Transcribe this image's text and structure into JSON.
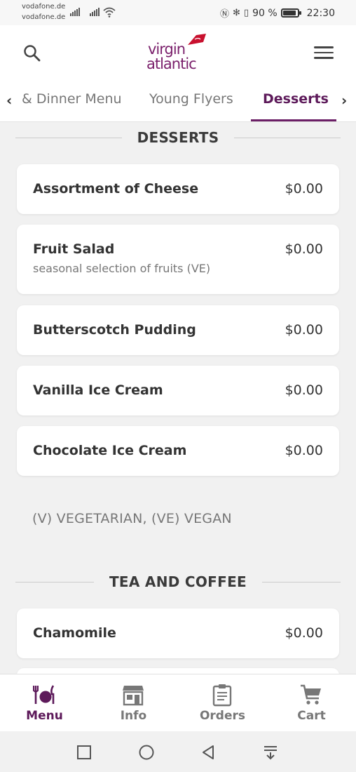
{
  "status_bar": {
    "carrier_1": "vodafone.de",
    "carrier_2": "vodafone.de",
    "battery_text": "90 %",
    "battery_level": 0.9,
    "time": "22:30"
  },
  "header": {
    "logo_line_1": "virgin",
    "logo_line_2": "atlantic",
    "brand_color": "#7a1f6b",
    "icons": [
      "search-icon",
      "hamburger-menu-icon"
    ]
  },
  "tabs": {
    "prev_label": "‹",
    "next_label": "›",
    "items": [
      {
        "label": "& Dinner Menu",
        "active": false
      },
      {
        "label": "Young Flyers",
        "active": false
      },
      {
        "label": "Desserts",
        "active": true
      }
    ]
  },
  "sections": [
    {
      "title": "DESSERTS",
      "items": [
        {
          "name": "Assortment of Cheese",
          "description": "",
          "price": "$0.00"
        },
        {
          "name": "Fruit Salad",
          "description": "seasonal selection of fruits (VE)",
          "price": "$0.00"
        },
        {
          "name": "Butterscotch Pudding",
          "description": "",
          "price": "$0.00"
        },
        {
          "name": "Vanilla Ice Cream",
          "description": "",
          "price": "$0.00"
        },
        {
          "name": "Chocolate Ice Cream",
          "description": "",
          "price": "$0.00"
        }
      ],
      "legend": "(V) VEGETARIAN, (VE) VEGAN"
    },
    {
      "title": "TEA AND COFFEE",
      "items": [
        {
          "name": "Chamomile",
          "description": "",
          "price": "$0.00"
        }
      ]
    }
  ],
  "bottom_nav": {
    "items": [
      {
        "label": "Menu",
        "icon": "cutlery-plate-icon",
        "active": true
      },
      {
        "label": "Info",
        "icon": "storefront-icon",
        "active": false
      },
      {
        "label": "Orders",
        "icon": "clipboard-icon",
        "active": false
      },
      {
        "label": "Cart",
        "icon": "cart-icon",
        "active": false
      }
    ],
    "active_color": "#5d1a5a"
  },
  "system_nav": {
    "icons": [
      "recent-apps-icon",
      "home-icon",
      "back-icon",
      "notification-pull-icon"
    ]
  }
}
